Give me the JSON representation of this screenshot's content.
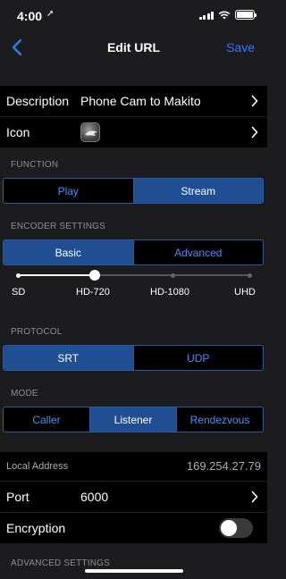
{
  "status_bar": {
    "time": "4:00",
    "location_glyph": "➚"
  },
  "nav": {
    "title": "Edit URL",
    "save_label": "Save"
  },
  "rows": {
    "description": {
      "label": "Description",
      "value": "Phone Cam to Makito"
    },
    "icon": {
      "label": "Icon"
    }
  },
  "function": {
    "header": "FUNCTION",
    "options": [
      "Play",
      "Stream"
    ],
    "selected": "Stream"
  },
  "encoder": {
    "header": "ENCODER SETTINGS",
    "options": [
      "Basic",
      "Advanced"
    ],
    "selected": "Basic",
    "quality_labels": [
      "SD",
      "HD-720",
      "HD-1080",
      "UHD"
    ],
    "quality_selected_index": 1
  },
  "protocol": {
    "header": "PROTOCOL",
    "options": [
      "SRT",
      "UDP"
    ],
    "selected": "SRT"
  },
  "mode": {
    "header": "MODE",
    "options": [
      "Caller",
      "Listener",
      "Rendezvous"
    ],
    "selected": "Listener"
  },
  "network": {
    "local_address_label": "Local Address",
    "local_address_value": "169.254.27.79",
    "port_label": "Port",
    "port_value": "6000",
    "encryption_label": "Encryption",
    "encryption_on": false
  },
  "advanced": {
    "header": "ADVANCED SETTINGS"
  },
  "colors": {
    "accent": "#3478f6",
    "segment_active": "#1f4e92",
    "background": "#1c1c1e"
  }
}
